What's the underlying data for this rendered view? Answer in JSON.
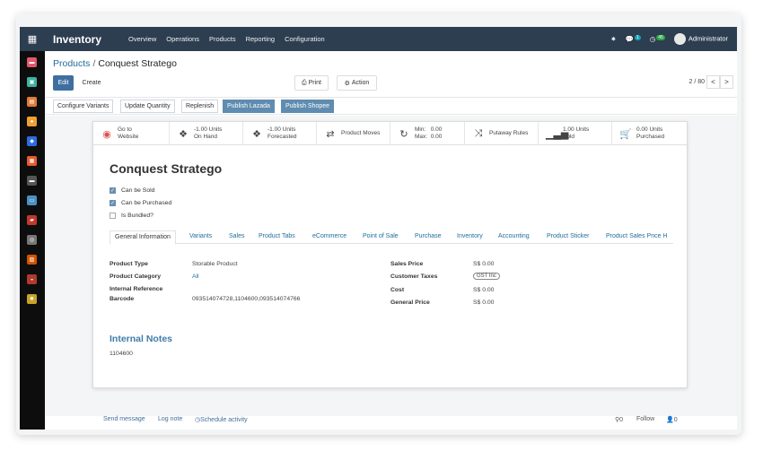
{
  "topbar": {
    "app_name": "Inventory",
    "menu": [
      "Overview",
      "Operations",
      "Products",
      "Reporting",
      "Configuration"
    ],
    "messages_count": "1",
    "activities_count": "45",
    "user_name": "Administrator"
  },
  "breadcrumb": {
    "parent": "Products",
    "separator": "/",
    "current": "Conquest Stratego"
  },
  "controls": {
    "edit": "Edit",
    "create": "Create",
    "print": "Print",
    "action": "Action",
    "pager": "2 / 80",
    "prev": "<",
    "next": ">"
  },
  "action_buttons": [
    "Configure Variants",
    "Update Quantity",
    "Replenish",
    "Publish Lazada",
    "Publish Shopee"
  ],
  "smart_buttons": [
    {
      "icon": "globe-icon",
      "line1": "Go to",
      "line2": "Website"
    },
    {
      "icon": "cubes-icon",
      "line1": "-1.00 Units",
      "line2": "On Hand"
    },
    {
      "icon": "cubes-icon",
      "line1": "-1.00 Units",
      "line2": "Forecasted"
    },
    {
      "icon": "exchange-icon",
      "line1": "Product Moves",
      "line2": ""
    },
    {
      "icon": "refresh-icon",
      "line1": "Min:   0.00",
      "line2": "Max:  0.00"
    },
    {
      "icon": "random-icon",
      "line1": "Putaway Rules",
      "line2": ""
    },
    {
      "icon": "signal-icon",
      "line1": "1.00 Units",
      "line2": "Sold"
    },
    {
      "icon": "cart-icon",
      "line1": "0.00 Units",
      "line2": "Purchased"
    }
  ],
  "product": {
    "name": "Conquest Stratego",
    "can_be_sold": {
      "label": "Can be Sold",
      "checked": true
    },
    "can_be_purchased": {
      "label": "Can be Purchased",
      "checked": true
    },
    "is_bundled": {
      "label": "Is Bundled?",
      "checked": false
    }
  },
  "tabs": [
    "General Information",
    "Variants",
    "Sales",
    "Product Tabs",
    "eCommerce",
    "Point of Sale",
    "Purchase",
    "Inventory",
    "Accounting",
    "Product Sticker",
    "Product Sales Price H"
  ],
  "general_info": {
    "left": [
      {
        "label": "Product Type",
        "value": "Storable Product"
      },
      {
        "label": "Product Category",
        "value": "All"
      },
      {
        "label": "Internal Reference",
        "value": ""
      },
      {
        "label": "Barcode",
        "value": "093514074728,1104600,093514074766"
      }
    ],
    "right": [
      {
        "label": "Sales Price",
        "value": "S$ 0.00"
      },
      {
        "label": "Customer Taxes",
        "value": "GST Inc"
      },
      {
        "label": "Cost",
        "value": "S$ 0.00"
      },
      {
        "label": "General Price",
        "value": "S$ 0.00"
      }
    ]
  },
  "notes": {
    "title": "Internal Notes",
    "body": "1104600"
  },
  "chatter": {
    "send_message": "Send message",
    "log_note": "Log note",
    "schedule_activity": "Schedule activity",
    "attachments": "0",
    "follow": "Follow",
    "followers": "0"
  },
  "colors": {
    "topbar": "#2c3e50",
    "primary": "#3f6fa0",
    "link": "#1f6d9c",
    "publish_button": "#5f8cb0"
  }
}
